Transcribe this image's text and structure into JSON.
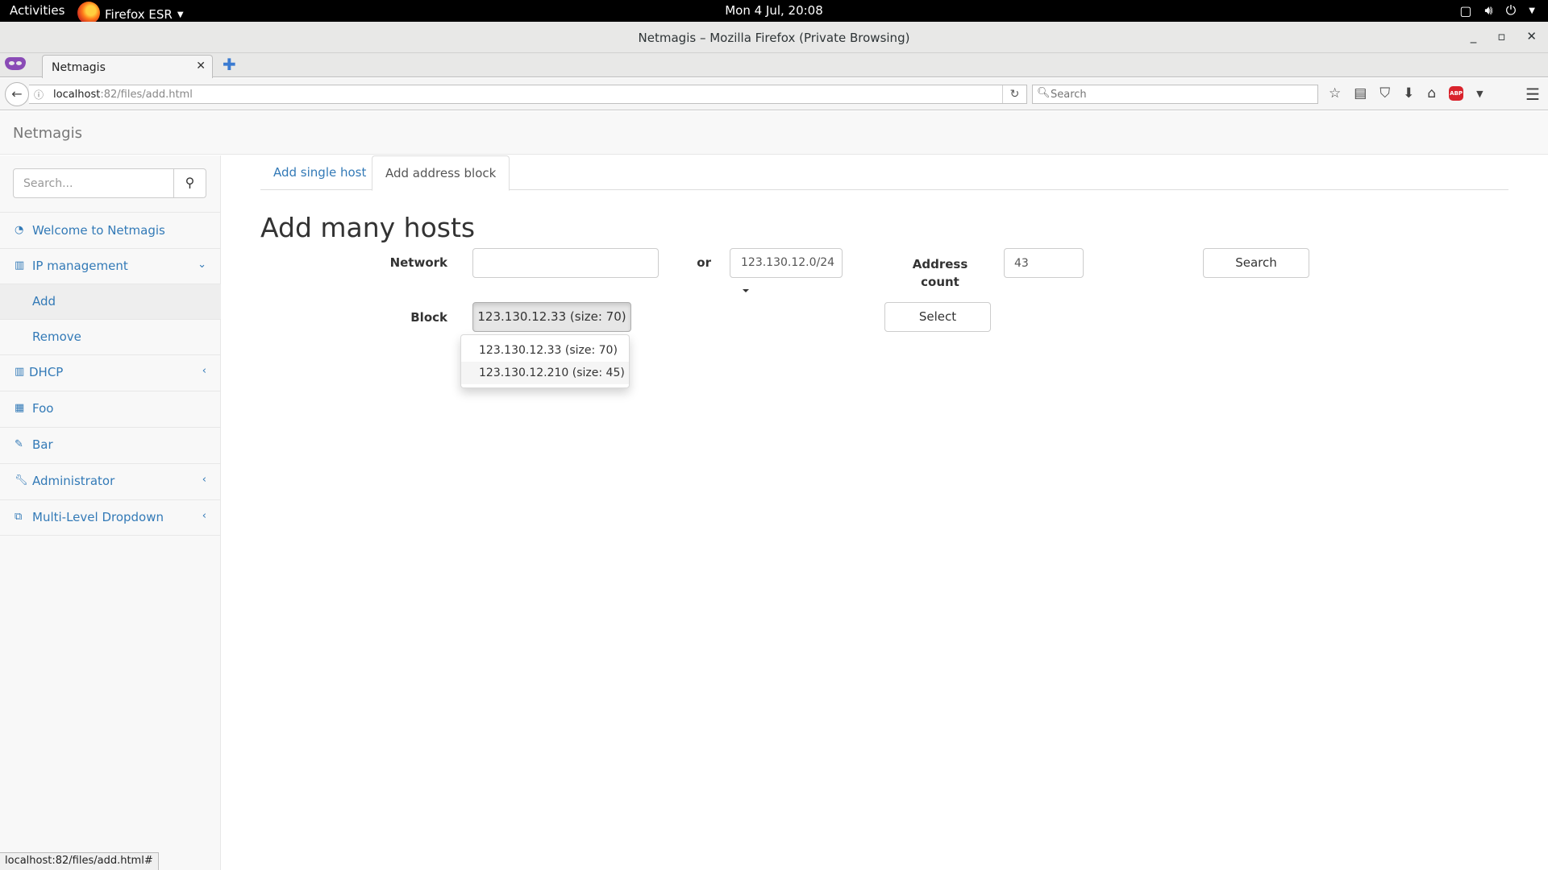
{
  "gnome": {
    "activities": "Activities",
    "app_menu": "Firefox ESR",
    "clock": "Mon  4 Jul, 20:08"
  },
  "window": {
    "title": "Netmagis – Mozilla Firefox (Private Browsing)"
  },
  "browser": {
    "tab_title": "Netmagis",
    "url_host": "localhost",
    "url_rest": ":82/files/add.html",
    "search_placeholder": "Search",
    "status_url": "localhost:82/files/add.html#"
  },
  "app": {
    "brand": "Netmagis"
  },
  "sidebar": {
    "search_placeholder": "Search...",
    "items": [
      {
        "label": "Welcome to Netmagis",
        "icon": "dashboard-icon"
      },
      {
        "label": "IP management",
        "icon": "bar-chart-icon",
        "expanded": true
      },
      {
        "label": "Add",
        "sub": true,
        "active": true
      },
      {
        "label": "Remove",
        "sub": true
      },
      {
        "label": "DHCP",
        "icon": "bar-chart-icon"
      },
      {
        "label": "Foo",
        "icon": "table-icon"
      },
      {
        "label": "Bar",
        "icon": "edit-icon"
      },
      {
        "label": "Administrator",
        "icon": "wrench-icon"
      },
      {
        "label": "Multi-Level Dropdown",
        "icon": "sitemap-icon"
      }
    ]
  },
  "main": {
    "tabs": [
      {
        "label": "Add single host",
        "active": false
      },
      {
        "label": "Add address block",
        "active": true
      }
    ],
    "title": "Add many hosts",
    "form": {
      "network_label": "Network",
      "network_value": "",
      "or_label": "or",
      "network_select": "123.130.12.0/24",
      "address_count_label_1": "Address",
      "address_count_label_2": "count",
      "address_count_value": "43",
      "search_button": "Search",
      "block_label": "Block",
      "block_selected": "123.130.12.33 (size: 70)",
      "select_button": "Select"
    },
    "block_options": [
      "123.130.12.33 (size: 70)",
      "123.130.12.210 (size: 45)"
    ]
  }
}
